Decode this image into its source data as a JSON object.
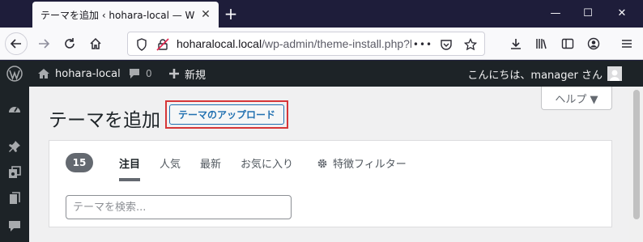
{
  "browser": {
    "tab_title": "テーマを追加 ‹ hohara-local — WordPress",
    "tab_close": "✕",
    "new_tab": "+",
    "window_controls": {
      "minimize": "—",
      "maximize": "☐",
      "close": "✕"
    },
    "url_domain": "hoharalocal.local",
    "url_path": "/wp-admin/theme-install.php?b",
    "url_more": "•••"
  },
  "adminbar": {
    "site_name": "hohara-local",
    "comments_count": "0",
    "new_label": "新規",
    "greeting": "こんにちは、manager さん"
  },
  "page": {
    "help_label": "ヘルプ ▼",
    "title": "テーマを追加",
    "upload_button": "テーマのアップロード",
    "highlight_color": "#d63638",
    "accent_color": "#2271b1"
  },
  "filter": {
    "count": "15",
    "tabs": [
      {
        "label": "注目",
        "active": true
      },
      {
        "label": "人気",
        "active": false
      },
      {
        "label": "最新",
        "active": false
      },
      {
        "label": "お気に入り",
        "active": false
      }
    ],
    "feature_filter_label": "特徴フィルター",
    "search_placeholder": "テーマを検索..."
  },
  "icons": {
    "browser": [
      "back-icon",
      "forward-icon",
      "reload-icon",
      "home-icon",
      "shield-icon",
      "lock-icon",
      "pocket-icon",
      "star-icon",
      "download-icon",
      "library-icon",
      "sidebar-icon",
      "account-icon",
      "menu-icon"
    ],
    "adminbar": [
      "wordpress-logo-icon",
      "home-icon",
      "comment-icon",
      "plus-icon"
    ],
    "sidemenu": [
      "dashboard-icon",
      "pin-icon",
      "media-icon",
      "pages-icon",
      "comments-icon"
    ]
  }
}
